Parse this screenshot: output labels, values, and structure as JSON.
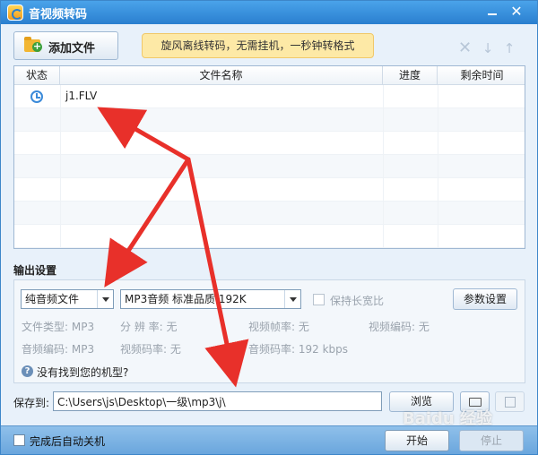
{
  "window": {
    "title": "音视频转码",
    "close_glyph": "✕"
  },
  "toolbar": {
    "add_file_label": "添加文件",
    "promo_text": "旋风离线转码，无需挂机，一秒钟转格式",
    "delete_glyph": "✕",
    "down_glyph": "↓",
    "up_glyph": "↑"
  },
  "table": {
    "headers": {
      "status": "状态",
      "name": "文件名称",
      "progress": "进度",
      "remaining": "剩余时间"
    },
    "files": [
      {
        "name": "j1.FLV"
      }
    ]
  },
  "output": {
    "section_title": "输出设置",
    "type_value": "纯音频文件",
    "format_value": "MP3音频 标准品质 192K",
    "keep_aspect_label": "保持长宽比",
    "param_button": "参数设置",
    "info": {
      "file_type": "文件类型:  MP3",
      "resolution": "分 辨 率:   无",
      "frame_rate": "视频帧率:   无",
      "video_codec": "视频编码:   无",
      "audio_codec": "音频编码:  MP3",
      "video_bitrate": "视频码率:   无",
      "audio_bitrate": "音频码率:   192 kbps"
    },
    "help_link": "没有找到您的机型?"
  },
  "save": {
    "label": "保存到:",
    "path": "C:\\Users\\js\\Desktop\\一级\\mp3\\j\\",
    "browse_button": "浏览"
  },
  "bottom": {
    "shutdown_label": "完成后自动关机",
    "start_button": "开始",
    "stop_button": "停止"
  },
  "watermark": "Baidu 经验",
  "colors": {
    "annotation_arrow": "#e8302a",
    "title_bar": "#2a7fcf"
  }
}
